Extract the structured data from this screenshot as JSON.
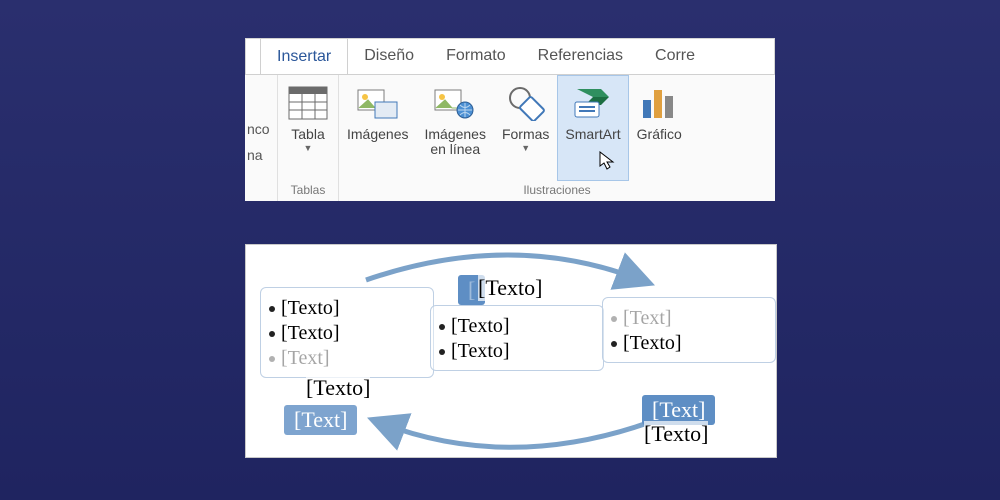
{
  "ribbon": {
    "tabs": [
      {
        "label": "Insertar",
        "active": true
      },
      {
        "label": "Diseño"
      },
      {
        "label": "Formato"
      },
      {
        "label": "Referencias"
      },
      {
        "label": "Corre"
      }
    ],
    "truncated": {
      "line1": "nco",
      "line2": "na"
    },
    "groups": {
      "tables": {
        "label": "Tablas",
        "table_btn": "Tabla"
      },
      "illustrations": {
        "label": "Ilustraciones",
        "images_btn": "Imágenes",
        "images_online_btn1": "Imágenes",
        "images_online_btn2": "en línea",
        "shapes_btn": "Formas",
        "smartart_btn": "SmartArt",
        "chart_btn": "Gráfico"
      }
    }
  },
  "smartart": {
    "placeholder": "[Texto]",
    "placeholder_trunc": "[Text]",
    "box1": {
      "row1": "[Texto]",
      "row2": "[Texto]",
      "row3": "[Texto]",
      "title_overlay": "[Text]"
    },
    "box2": {
      "title": "[Texto]",
      "row1": "[Texto]",
      "row2": "[Texto]"
    },
    "box3": {
      "row1": "[Text]",
      "row2": "[Texto]",
      "title_overlay": "[Text]",
      "title_overlay_sel": "[Texto]"
    }
  }
}
